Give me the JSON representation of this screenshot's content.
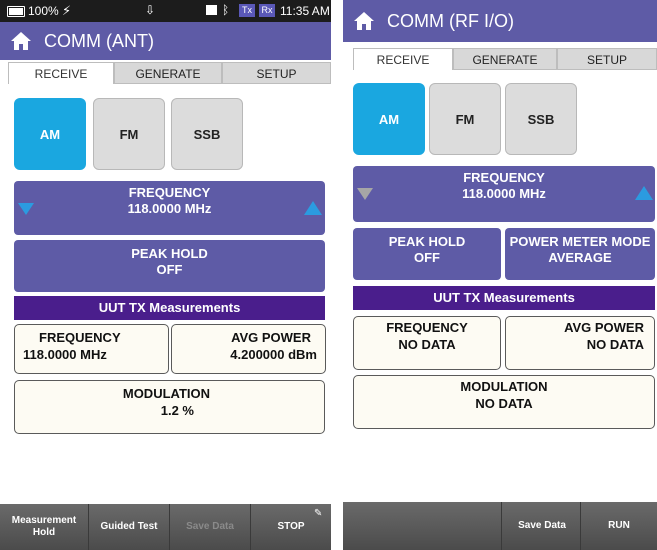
{
  "left": {
    "status": {
      "battery": "100%",
      "tx": "Tx",
      "rx": "Rx",
      "time": "11:35 AM"
    },
    "title": "COMM (ANT)",
    "tabs": [
      {
        "label": "RECEIVE"
      },
      {
        "label": "GENERATE"
      },
      {
        "label": "SETUP"
      }
    ],
    "modes": [
      {
        "label": "AM"
      },
      {
        "label": "FM"
      },
      {
        "label": "SSB"
      }
    ],
    "frequency": {
      "label": "FREQUENCY",
      "value": "118.0000 MHz"
    },
    "peak_hold": {
      "label": "PEAK HOLD",
      "value": "OFF"
    },
    "uut_title": "UUT TX Measurements",
    "meas_frequency": {
      "label": "FREQUENCY",
      "value": "118.0000 MHz"
    },
    "meas_avg_power": {
      "label": "AVG POWER",
      "value": "4.200000 dBm"
    },
    "meas_modulation": {
      "label": "MODULATION",
      "value": "1.2 %"
    },
    "bottom": {
      "measurement_hold_1": "Measurement",
      "measurement_hold_2": "Hold",
      "guided_test": "Guided Test",
      "save_data": "Save Data",
      "stop": "STOP"
    }
  },
  "right": {
    "title": "COMM (RF I/O)",
    "tabs": [
      {
        "label": "RECEIVE"
      },
      {
        "label": "GENERATE"
      },
      {
        "label": "SETUP"
      }
    ],
    "modes": [
      {
        "label": "AM"
      },
      {
        "label": "FM"
      },
      {
        "label": "SSB"
      }
    ],
    "frequency": {
      "label": "FREQUENCY",
      "value": "118.0000 MHz"
    },
    "peak_hold": {
      "label": "PEAK HOLD",
      "value": "OFF"
    },
    "power_meter_mode": {
      "label": "POWER METER MODE",
      "value": "AVERAGE"
    },
    "uut_title": "UUT TX Measurements",
    "meas_frequency": {
      "label": "FREQUENCY",
      "value": "NO DATA"
    },
    "meas_avg_power": {
      "label": "AVG POWER",
      "value": "NO DATA"
    },
    "meas_modulation": {
      "label": "MODULATION",
      "value": "NO DATA"
    },
    "bottom": {
      "save_data": "Save Data",
      "run": "RUN"
    }
  },
  "colors": {
    "title_bar": "#5e5ba6",
    "active_mode": "#1aa7e0",
    "uut_bar": "#4a1e8c",
    "arrow_blue": "#2b9be0"
  },
  "icons": [
    "home-icon",
    "battery-icon",
    "charging-icon",
    "download-icon",
    "bluetooth-icon",
    "tx-indicator",
    "rx-indicator",
    "arrow-down-icon",
    "arrow-up-icon",
    "pin-icon"
  ]
}
